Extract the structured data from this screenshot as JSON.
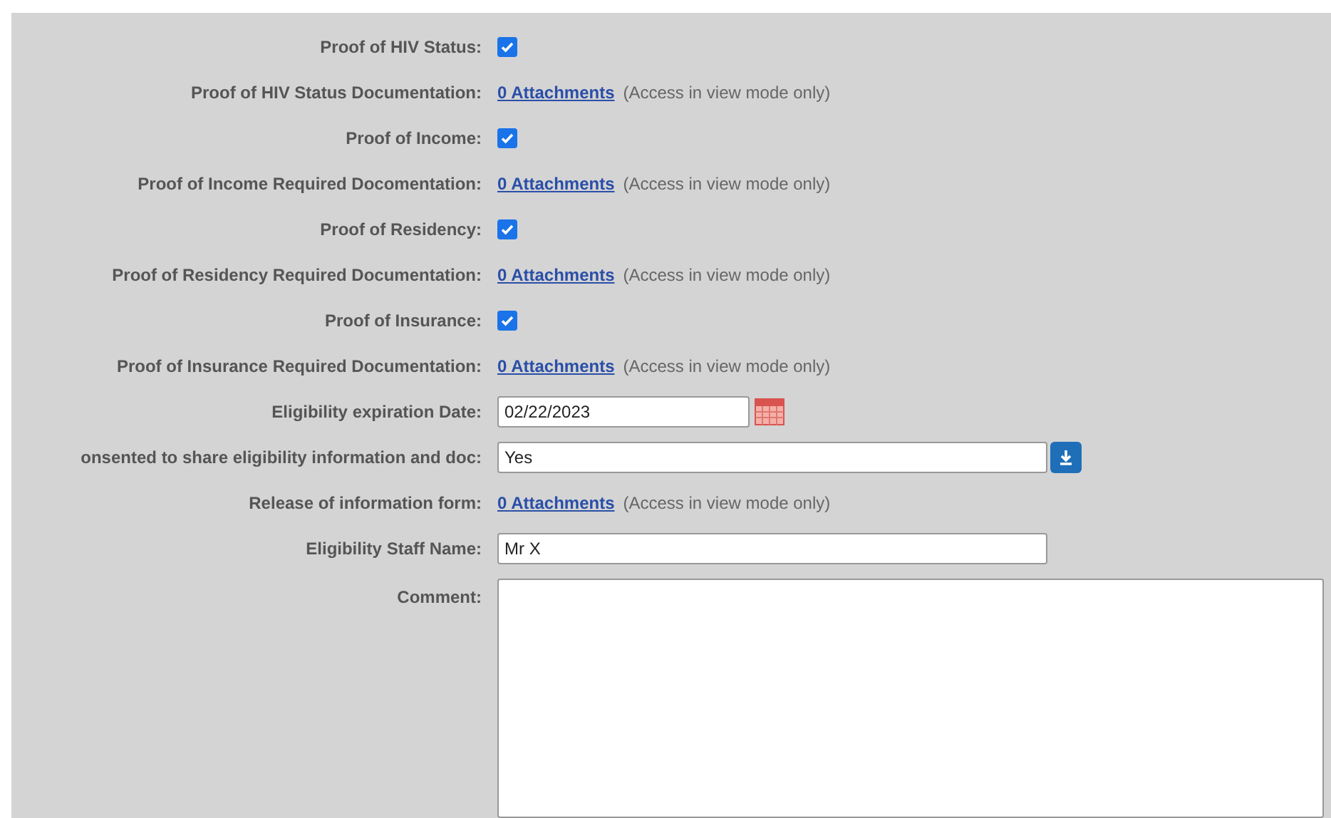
{
  "fields": [
    {
      "kind": "checkbox",
      "label": "Proof of HIV Status:",
      "checked": true
    },
    {
      "kind": "attachments",
      "label": "Proof of HIV Status Documentation:",
      "link": "0 Attachments",
      "note": "(Access in view mode only)"
    },
    {
      "kind": "checkbox",
      "label": "Proof of Income:",
      "checked": true
    },
    {
      "kind": "attachments",
      "label": "Proof of Income Required Docomentation:",
      "link": "0 Attachments",
      "note": "(Access in view mode only)"
    },
    {
      "kind": "checkbox",
      "label": "Proof of Residency:",
      "checked": true
    },
    {
      "kind": "attachments",
      "label": "Proof of Residency Required Documentation:",
      "link": "0 Attachments",
      "note": "(Access in view mode only)"
    },
    {
      "kind": "checkbox",
      "label": "Proof of Insurance:",
      "checked": true
    },
    {
      "kind": "attachments",
      "label": "Proof of Insurance Required Documentation:",
      "link": "0 Attachments",
      "note": "(Access in view mode only)"
    },
    {
      "kind": "date",
      "label": "Eligibility expiration Date:",
      "value": "02/22/2023"
    },
    {
      "kind": "select",
      "label": "onsented to share eligibility information and doc:",
      "value": "Yes"
    },
    {
      "kind": "attachments",
      "label": "Release of information form:",
      "link": "0 Attachments",
      "note": "(Access in view mode only)"
    },
    {
      "kind": "text",
      "label": "Eligibility Staff Name:",
      "value": "Mr X"
    },
    {
      "kind": "textarea",
      "label": "Comment:"
    }
  ]
}
